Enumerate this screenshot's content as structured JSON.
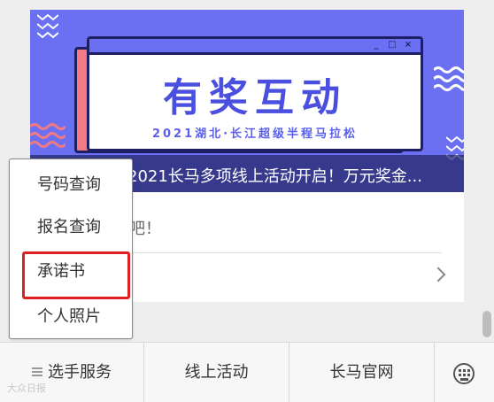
{
  "article": {
    "banner": {
      "title": "有奖互动",
      "subtitle": "2021湖北·长江超级半程马拉松",
      "window_controls": [
        "_",
        "□",
        "×"
      ],
      "colors": {
        "background": "#6b70f2",
        "window_shadow": "#f07b84",
        "outline": "#1e1f62",
        "text": "#4a4fe0"
      }
    },
    "headline": "2021长马多项线上活动开启！万元奖金...",
    "snippet": "吧！"
  },
  "popup_menu": {
    "items": [
      {
        "label": "号码查询"
      },
      {
        "label": "报名查询"
      },
      {
        "label": "承诺书",
        "highlighted": true
      },
      {
        "label": "个人照片"
      }
    ],
    "highlight_color": "#e02020"
  },
  "tabbar": {
    "tabs": [
      {
        "label": "选手服务",
        "icon": "menu-icon"
      },
      {
        "label": "线上活动"
      },
      {
        "label": "长马官网"
      }
    ],
    "keyboard_icon": "keyboard-icon"
  },
  "watermark": "大众日报"
}
